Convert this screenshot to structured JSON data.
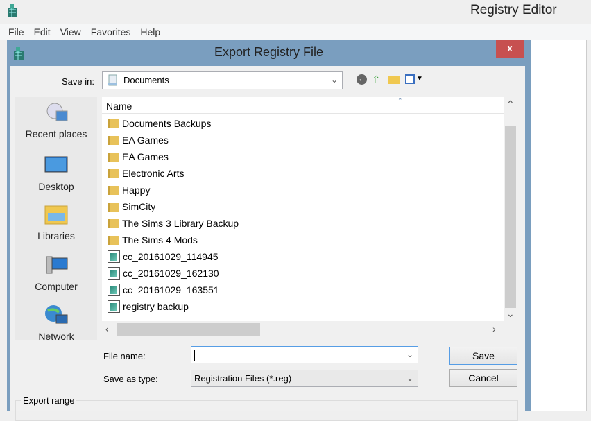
{
  "app": {
    "title": "Registry Editor",
    "menu": [
      "File",
      "Edit",
      "View",
      "Favorites",
      "Help"
    ]
  },
  "dialog": {
    "title": "Export Registry File",
    "close_label": "x",
    "save_in_label": "Save in:",
    "save_in_value": "Documents",
    "places": [
      "Recent places",
      "Desktop",
      "Libraries",
      "Computer",
      "Network"
    ],
    "list_header": "Name",
    "items": [
      {
        "name": "Documents Backups",
        "type": "folder"
      },
      {
        "name": "EA Games",
        "type": "folder"
      },
      {
        "name": "EA Games",
        "type": "folder"
      },
      {
        "name": "Electronic Arts",
        "type": "folder"
      },
      {
        "name": "Happy",
        "type": "folder"
      },
      {
        "name": "SimCity",
        "type": "folder"
      },
      {
        "name": "The Sims 3 Library Backup",
        "type": "folder"
      },
      {
        "name": "The Sims 4 Mods",
        "type": "folder"
      },
      {
        "name": "cc_20161029_114945",
        "type": "reg"
      },
      {
        "name": "cc_20161029_162130",
        "type": "reg"
      },
      {
        "name": "cc_20161029_163551",
        "type": "reg"
      },
      {
        "name": "registry backup",
        "type": "reg"
      }
    ],
    "file_name_label": "File name:",
    "file_name_value": "",
    "save_as_type_label": "Save as type:",
    "save_as_type_value": "Registration Files (*.reg)",
    "save_label": "Save",
    "cancel_label": "Cancel",
    "export_range_label": "Export range"
  }
}
